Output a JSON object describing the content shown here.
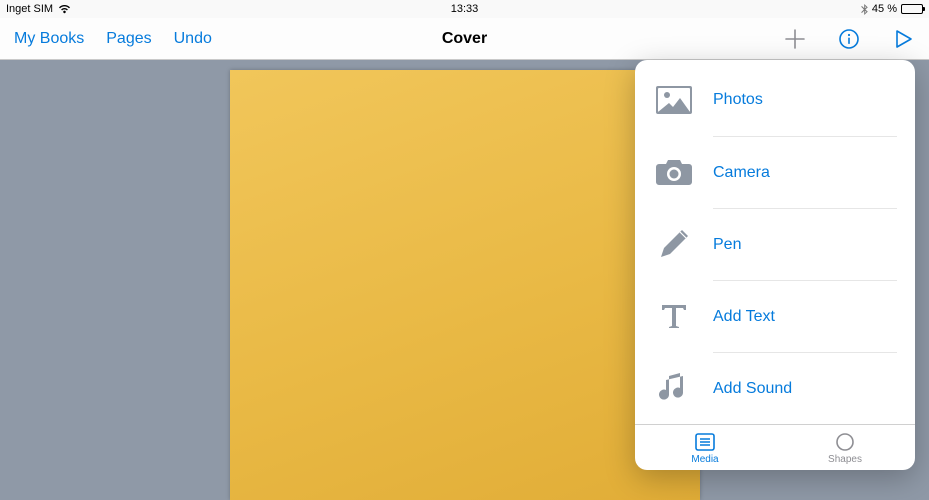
{
  "status": {
    "carrier": "Inget SIM",
    "time": "13:33",
    "battery_pct": "45 %"
  },
  "nav": {
    "left": {
      "my_books": "My Books",
      "pages": "Pages",
      "undo": "Undo"
    },
    "title": "Cover"
  },
  "popover": {
    "items": [
      {
        "icon": "photos-icon",
        "label": "Photos"
      },
      {
        "icon": "camera-icon",
        "label": "Camera"
      },
      {
        "icon": "pen-icon",
        "label": "Pen"
      },
      {
        "icon": "text-icon",
        "label": "Add Text"
      },
      {
        "icon": "sound-icon",
        "label": "Add Sound"
      }
    ],
    "tabs": {
      "media": "Media",
      "shapes": "Shapes"
    }
  },
  "colors": {
    "ios_blue": "#067bdc",
    "cover_yellow": "#ecbd4a",
    "canvas_bg": "#8f99a7",
    "icon_gray": "#8e97a3"
  }
}
